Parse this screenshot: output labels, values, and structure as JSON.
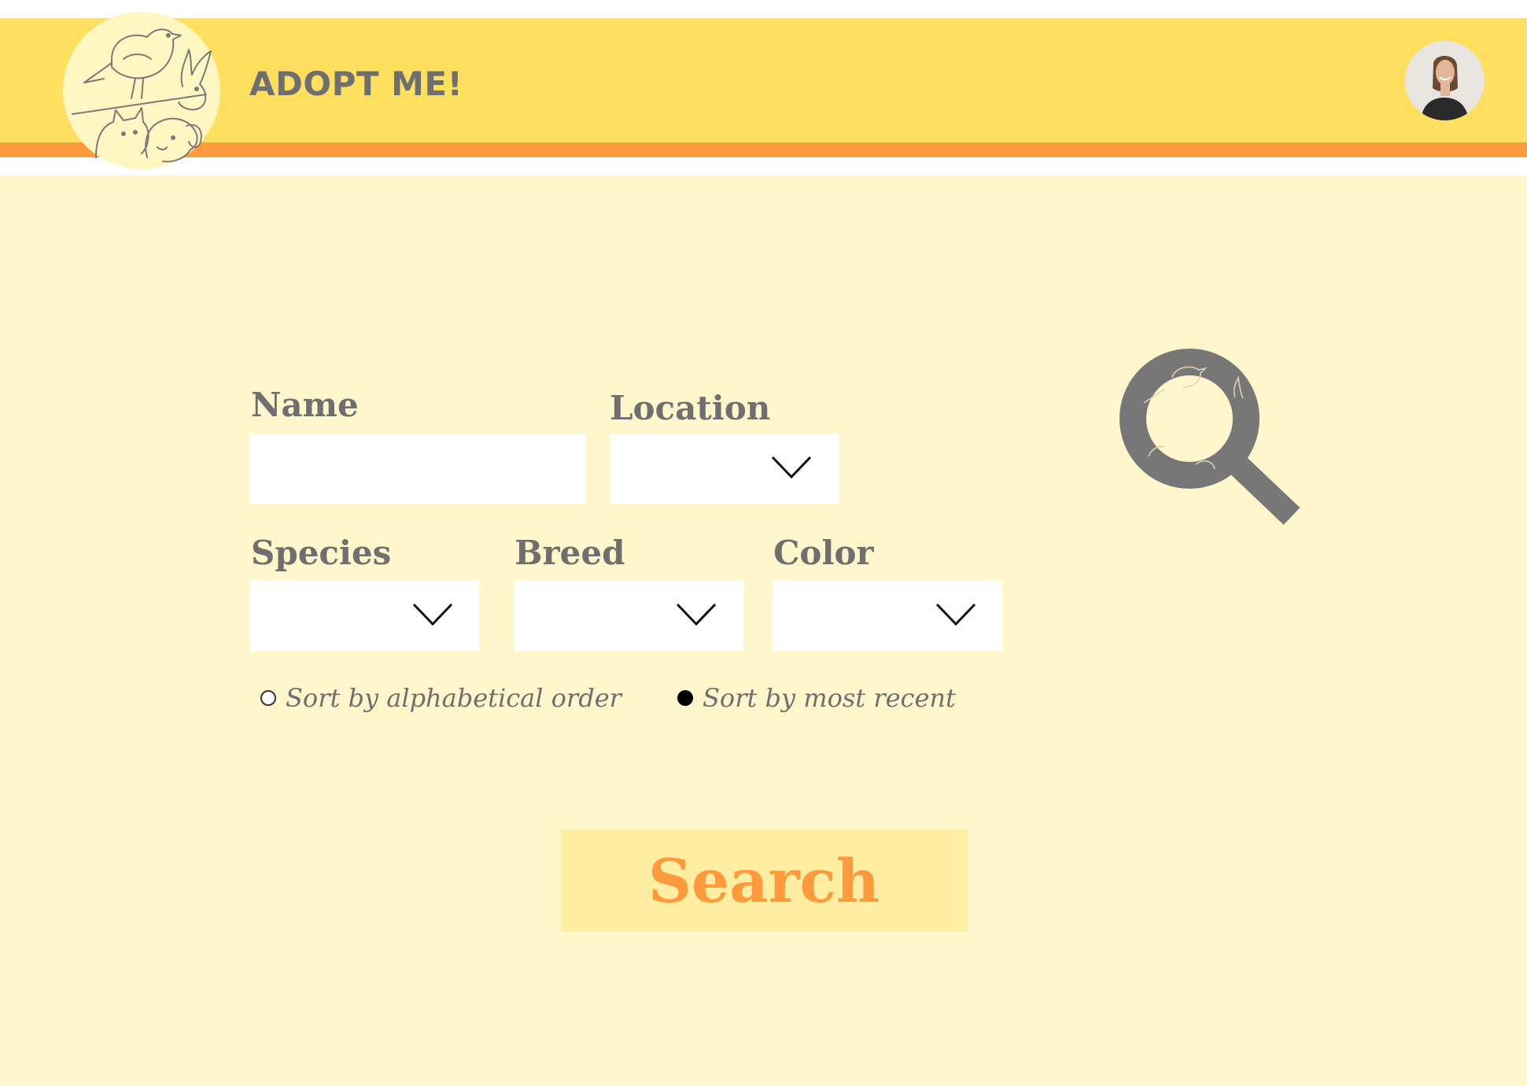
{
  "header": {
    "title": "ADOPT ME!",
    "logo_icon": "pets-logo-icon",
    "avatar_icon": "user-avatar-icon"
  },
  "form": {
    "name_label": "Name",
    "name_value": "",
    "location_label": "Location",
    "species_label": "Species",
    "breed_label": "Breed",
    "color_label": "Color"
  },
  "sort": {
    "alphabetical_label": "Sort by alphabetical order",
    "recent_label": "Sort by most recent",
    "selected": "most-recent"
  },
  "search_button": {
    "label": "Search"
  },
  "colors": {
    "header_yellow": "#ffdf5e",
    "header_orange": "#ff9a3c",
    "background": "#fff6cb",
    "button_bg": "#ffeea2",
    "button_text": "#ff9a3c",
    "label_gray": "#6f6f6f"
  }
}
